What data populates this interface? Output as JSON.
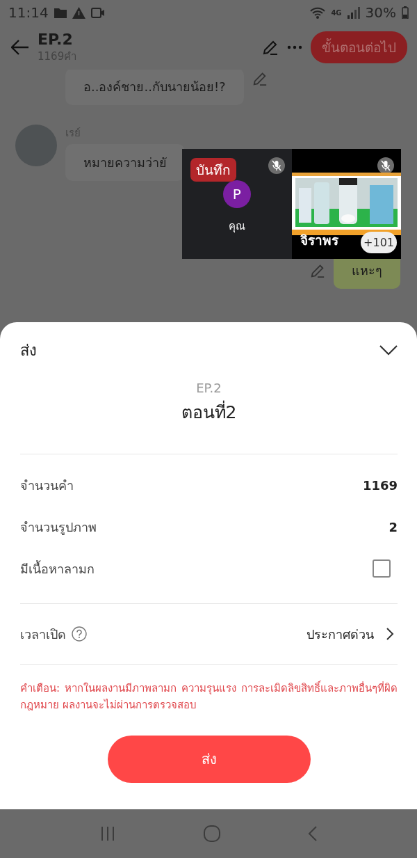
{
  "status_bar": {
    "time": "11:14",
    "network": "4G",
    "battery": "30%"
  },
  "header": {
    "title": "EP.2",
    "subtitle": "1169คำ",
    "next_button": "ขั้นตอนต่อไป"
  },
  "chat": {
    "messages": [
      {
        "kind": "incoming",
        "text": "อ..องค์ชาย..กับนายน้อย!?"
      },
      {
        "kind": "incoming",
        "sender": "เรย์",
        "text": "หมายความว่ายั"
      },
      {
        "kind": "outgoing",
        "text": "แหะๆ"
      }
    ]
  },
  "call_window": {
    "record_label": "บันทึก",
    "tiles": [
      {
        "kind": "avatar",
        "initial": "P",
        "name": "คุณ",
        "muted": true
      },
      {
        "kind": "video",
        "name": "จิราพร",
        "muted": true,
        "count": "+101"
      }
    ]
  },
  "sheet": {
    "title": "ส่ง",
    "episode": "EP.2",
    "episode_title": "ตอนที่2",
    "rows": [
      {
        "kind": "value",
        "label": "จำนวนคำ",
        "value": "1169"
      },
      {
        "kind": "value",
        "label": "จำนวนรูปภาพ",
        "value": "2"
      },
      {
        "kind": "checkbox",
        "label": "มีเนื้อหาลามก",
        "checked": false
      }
    ],
    "release": {
      "label": "เวลาเปิด",
      "value": "ประกาศด่วน"
    },
    "warning": "คำเตือน: หากในผลงานมีภาพลามก ความรุนแรง การละเมิดลิขสิทธิ์และภาพอื่นๆที่ผิดกฎหมาย ผลงานจะไม่ผ่านการตรวจสอบ",
    "submit_button": "ส่ง"
  }
}
